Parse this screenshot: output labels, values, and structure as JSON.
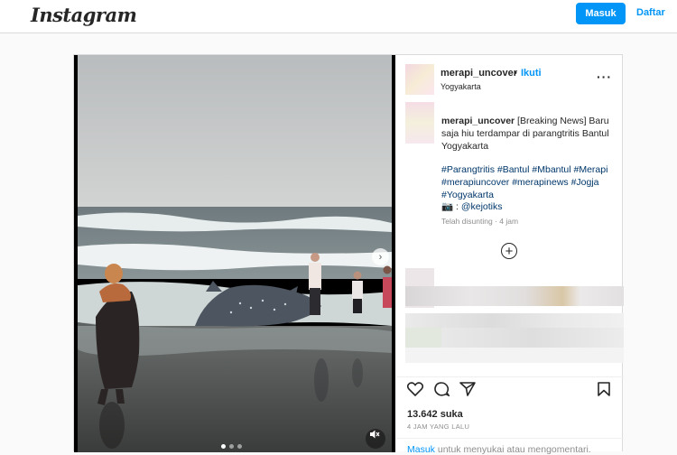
{
  "header": {
    "logo": "Instagram",
    "login_label": "Masuk",
    "signup_label": "Daftar"
  },
  "post": {
    "username": "merapi_uncover",
    "separator": "•",
    "follow_label": "Ikuti",
    "location": "Yogyakarta",
    "caption_username": "merapi_uncover",
    "caption_text": "[Breaking News] Baru saja hiu terdampar di parangtritis Bantul Yogyakarta",
    "hashtags": "#Parangtritis #Bantul #Mbantul #Merapi #merapiuncover #merapinews #Jogja #Yogyakarta",
    "credit_prefix": "📷 : ",
    "credit_handle": "@kejotiks",
    "edited_text": "Telah disunting · 4 jam",
    "likes": "13.642 suka",
    "time_ago": "4 JAM YANG LALU",
    "footer_link": "Masuk",
    "footer_text": " untuk menyukai atau mengomentari."
  },
  "media": {
    "image_alt": "Whale shark stranded on beach with onlookers",
    "total_slides": 3,
    "active_slide": 1
  },
  "icons": {
    "more": "more-options-icon",
    "add_comment": "plus-circle-icon",
    "like": "heart-icon",
    "comment": "comment-icon",
    "share": "share-icon",
    "save": "bookmark-icon",
    "next": "chevron-right-icon",
    "mute": "muted-speaker-icon"
  }
}
